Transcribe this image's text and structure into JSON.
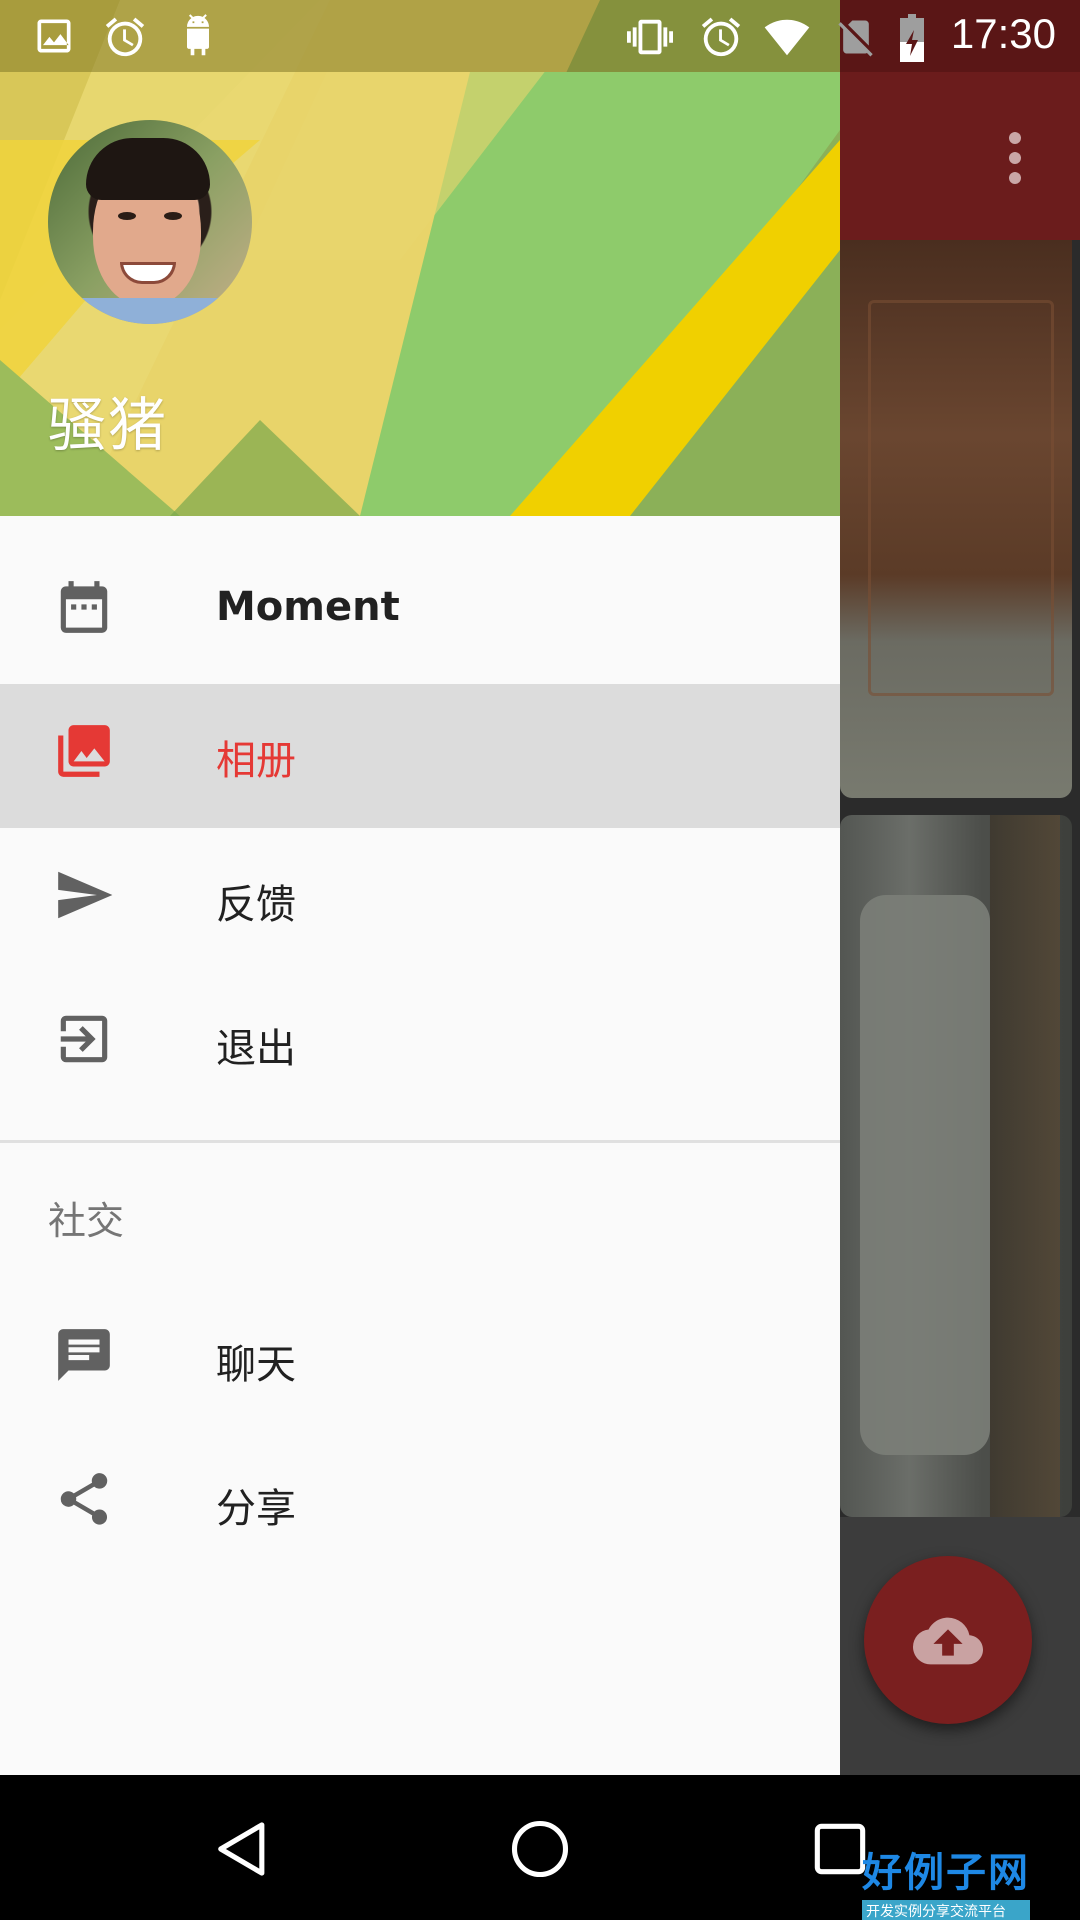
{
  "status_bar": {
    "time": "17:30",
    "icons": [
      "image-icon",
      "alarm-icon",
      "android-icon",
      "vibrate-icon",
      "alarm-icon",
      "wifi-icon",
      "no-sim-icon",
      "battery-charging-icon"
    ]
  },
  "drawer": {
    "header": {
      "user_name": "骚猪",
      "avatar_icon": "profile-photo"
    },
    "items": [
      {
        "label": "Moment",
        "icon": "calendar-icon",
        "active": false
      },
      {
        "label": "相册",
        "icon": "photo-library-icon",
        "active": true
      },
      {
        "label": "反馈",
        "icon": "send-icon",
        "active": false
      },
      {
        "label": "退出",
        "icon": "exit-icon",
        "active": false
      }
    ],
    "section": {
      "title": "社交",
      "items": [
        {
          "label": "聊天",
          "icon": "chat-icon"
        },
        {
          "label": "分享",
          "icon": "share-icon"
        }
      ]
    }
  },
  "app_bar": {
    "menu_icon": "more-vert-icon",
    "color": "#6b1c1c"
  },
  "fab": {
    "icon": "cloud-upload-icon",
    "color": "#7a1f1f"
  },
  "colors": {
    "accent": "#e53935",
    "drawer_bg": "#fafafa",
    "active_bg": "#dcdcdc"
  },
  "watermark": {
    "main": "好例子网",
    "sub": "开发实例分享交流平台"
  }
}
